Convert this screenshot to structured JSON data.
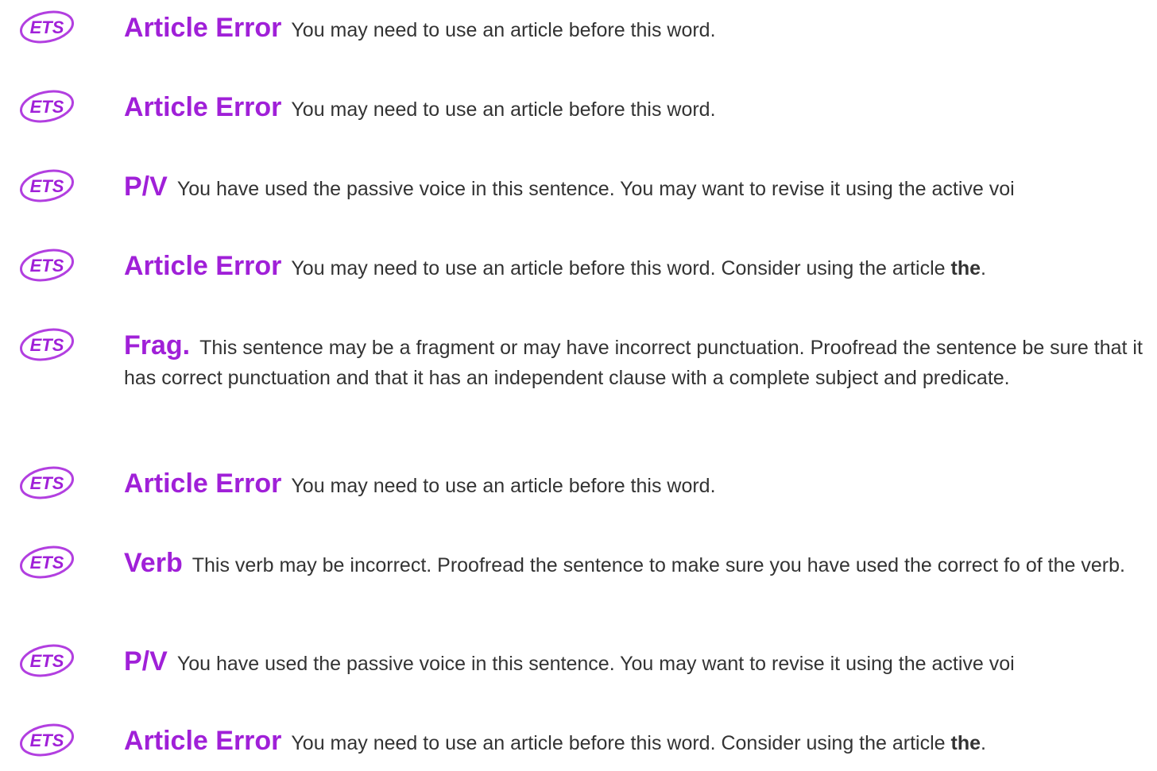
{
  "logo_text": "ETS",
  "colors": {
    "accent": "#a020d8",
    "text": "#333333",
    "logo_outline": "#b23fe0",
    "logo_fill": "#ffffff"
  },
  "items": [
    {
      "type": "Article Error",
      "message": "You may need to use an article before this word.",
      "suggestion": ""
    },
    {
      "type": "Article Error",
      "message": "You may need to use an article before this word.",
      "suggestion": ""
    },
    {
      "type": "P/V",
      "message": "You have used the passive voice in this sentence. You may want to revise it using the active voi",
      "suggestion": ""
    },
    {
      "type": "Article Error",
      "message": "You may need to use an article before this word. Consider using the article ",
      "suggestion": "the",
      "suffix": "."
    },
    {
      "type": "Frag.",
      "message": "This sentence may be a fragment or may have incorrect punctuation. Proofread the sentence be sure that it has correct punctuation and that it has an independent clause with a complete subject and predicate.",
      "suggestion": ""
    },
    {
      "type": "Article Error",
      "message": "You may need to use an article before this word.",
      "suggestion": ""
    },
    {
      "type": "Verb",
      "message": "This verb may be incorrect. Proofread the sentence to make sure you have used the correct fo of the verb.",
      "suggestion": ""
    },
    {
      "type": "P/V",
      "message": "You have used the passive voice in this sentence. You may want to revise it using the active voi",
      "suggestion": ""
    },
    {
      "type": "Article Error",
      "message": "You may need to use an article before this word. Consider using the article ",
      "suggestion": "the",
      "suffix": "."
    }
  ]
}
